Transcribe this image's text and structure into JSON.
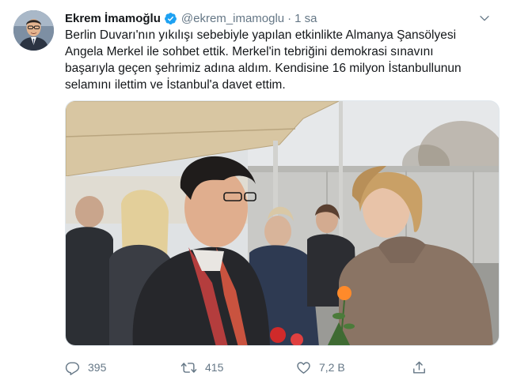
{
  "tweet": {
    "display_name": "Ekrem İmamoğlu",
    "handle": "@ekrem_imamoglu",
    "separator": "·",
    "time": "1 sa",
    "text_lines": [
      "Berlin Duvarı'nın yıkılışı sebebiyle yapılan etkinlikte Almanya Şansölyesi",
      "Angela Merkel ile sohbet ettik. Merkel'in tebriğini demokrasi sınavını",
      "başarıyla geçen şehrimiz adına aldım. Kendisine 16 milyon İstanbullunun",
      "selamını ilettim ve İstanbul'a davet ettim."
    ]
  },
  "actions": {
    "reply_count": "395",
    "retweet_count": "415",
    "like_count": "7,2 B"
  },
  "icons": {
    "verified": "verified-badge-icon",
    "menu": "chevron-down-icon",
    "reply": "reply-icon",
    "retweet": "retweet-icon",
    "like": "heart-icon",
    "share": "share-icon"
  },
  "colors": {
    "verified_blue": "#1da1f2",
    "secondary_text": "#657786",
    "primary_text": "#14171a"
  }
}
